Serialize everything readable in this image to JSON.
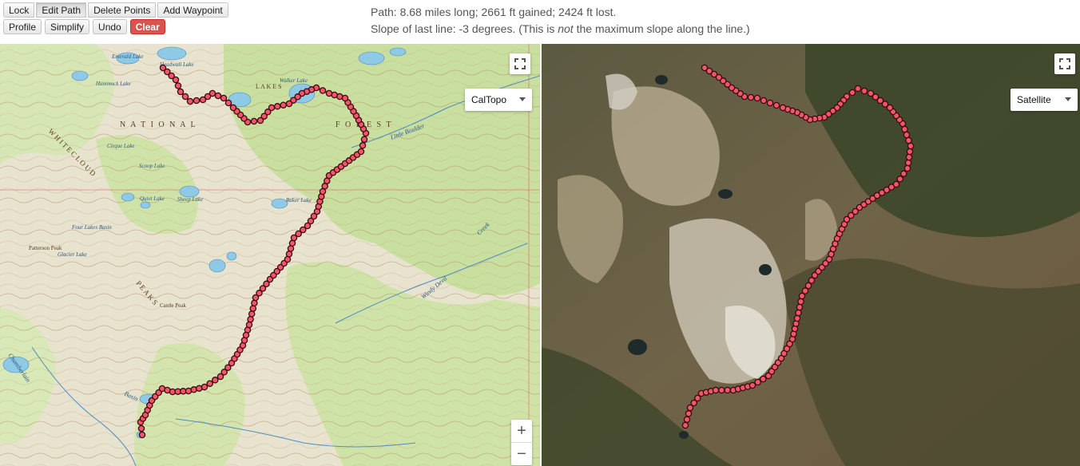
{
  "toolbar": {
    "row1": [
      "Lock",
      "Edit Path",
      "Delete Points",
      "Add Waypoint"
    ],
    "row2": [
      "Profile",
      "Simplify",
      "Undo",
      "Clear"
    ],
    "active": "Edit Path",
    "danger": "Clear"
  },
  "info": {
    "line1": "Path: 8.68 miles long; 2661 ft gained; 2424 ft lost.",
    "line2_pre": "Slope of last line: -3 degrees. (This is ",
    "line2_em": "not",
    "line2_post": " the maximum slope along the line.)"
  },
  "maps": {
    "left": {
      "layer": "CalTopo"
    },
    "right": {
      "layer": "Satellite"
    }
  },
  "zoom": {
    "in": "+",
    "out": "−"
  },
  "topo_labels": {
    "national": "N A T I O N A L",
    "forest": "F O R E S T",
    "cloud": "W H I T E   C L O U D",
    "peaks": "P E A K S",
    "lakes": "L A K E S",
    "little_boulder": "Little Boulder",
    "chamberlain": "Chamberlain",
    "basin": "Basin",
    "patterson_peak": "Patterson Peak",
    "castle_peak": "Castle Peak",
    "quiet_lake": "Quiet Lake",
    "four_lakes": "Four Lakes Basin",
    "baker_lake": "Baker Lake",
    "sheep_lake": "Sheep Lake",
    "scoop_lake": "Scoop Lake",
    "hummock_lake": "Hummock Lake",
    "walker_lake": "Walker Lake",
    "cirque_lake": "Cirque Lake",
    "emerald_lake": "Emerald Lake",
    "glacier_lake": "Glacier Lake",
    "headwall_lake": "Headwall Lake",
    "windy_devil": "Windy Devil",
    "creek": "Creek"
  }
}
